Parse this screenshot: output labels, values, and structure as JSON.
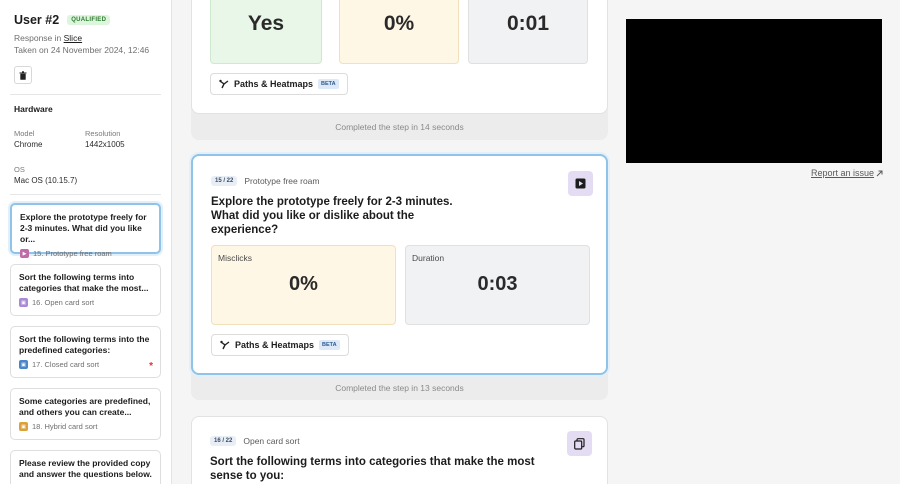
{
  "user": {
    "title": "User #2",
    "badge": "QUALIFIED",
    "response_prefix": "Response in ",
    "response_link": "Slice",
    "taken_on": "Taken on 24 November 2024, 12:46"
  },
  "hardware": {
    "heading": "Hardware",
    "model_label": "Model",
    "model_value": "Chrome",
    "resolution_label": "Resolution",
    "resolution_value": "1442x1005",
    "os_label": "OS",
    "os_value": "Mac OS (10.15.7)"
  },
  "sidebar_steps": [
    {
      "question": "Explore the prototype freely for 2-3 minutes. What did you like or...",
      "label": "15. Prototype free roam",
      "icon_color": "#c06ba8"
    },
    {
      "question": "Sort the following terms into categories that make the most...",
      "label": "16. Open card sort",
      "icon_color": "#a98ad4"
    },
    {
      "question": "Sort the following terms into the predefined categories:",
      "label": "17. Closed card sort",
      "icon_color": "#4a86c8",
      "required_mark": "*"
    },
    {
      "question": "Some categories are predefined, and others you can create...",
      "label": "18. Hybrid card sort",
      "icon_color": "#d9a23a"
    },
    {
      "question": "Please review the provided copy and answer the questions below.",
      "label": "",
      "icon_color": ""
    }
  ],
  "top_panel": {
    "metric1_value": "Yes",
    "metric2_value": "0%",
    "metric3_value": "0:01",
    "paths_label": "Paths & Heatmaps",
    "beta": "BETA",
    "completed": "Completed the step in 14 seconds"
  },
  "mid_panel": {
    "step_num": "15 / 22",
    "step_type": "Prototype free roam",
    "question": "Explore the prototype freely for 2-3 minutes. What did you like or dislike about the experience?",
    "misclicks_label": "Misclicks",
    "misclicks_value": "0%",
    "duration_label": "Duration",
    "duration_value": "0:03",
    "paths_label": "Paths & Heatmaps",
    "beta": "BETA",
    "completed": "Completed the step in 13 seconds"
  },
  "bottom_panel": {
    "step_num": "16 / 22",
    "step_type": "Open card sort",
    "question": "Sort the following terms into categories that make the most sense to you:"
  },
  "report_issue": "Report an issue",
  "colors": {
    "green_metric_bg": "#e9f7e9",
    "yellow_metric_bg": "#fff7e6",
    "active_border": "#8fc3ea",
    "type_icon_bg": "#e4dcf2"
  }
}
